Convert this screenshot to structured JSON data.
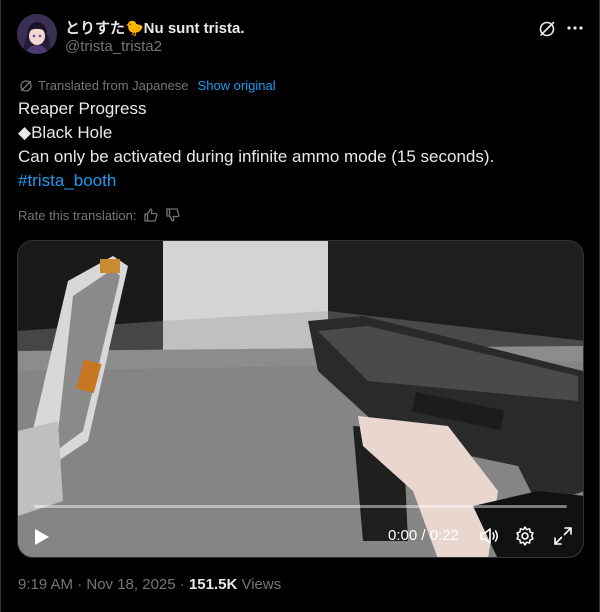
{
  "author": {
    "display_name": "とりすた🐤Nu sunt trista.",
    "handle": "@trista_trista2"
  },
  "translation": {
    "label": "Translated from Japanese",
    "show_original": "Show original",
    "rate_label": "Rate this translation:"
  },
  "tweet": {
    "line1": "Reaper Progress",
    "line2": "◆Black Hole",
    "line3": "Can only be activated during infinite ammo mode (15 seconds).",
    "hashtag": "#trista_booth"
  },
  "video": {
    "time": "0:00 / 0:22",
    "progress": 0
  },
  "meta": {
    "timestamp": "9:19 AM · Nov 18, 2025 · ",
    "views_count": "151.5K",
    "views_label": " Views"
  },
  "icons": {
    "more": "more-icon",
    "grok": "grok-icon",
    "translate": "translate-icon",
    "thumbs_up": "thumbs-up-icon",
    "thumbs_down": "thumbs-down-icon",
    "play": "play-icon",
    "volume": "volume-icon",
    "settings": "settings-icon",
    "fullscreen": "fullscreen-icon"
  },
  "colors": {
    "background": "#000000",
    "text": "#e7e9ea",
    "secondary": "#71767b",
    "link": "#1d9bf0"
  }
}
